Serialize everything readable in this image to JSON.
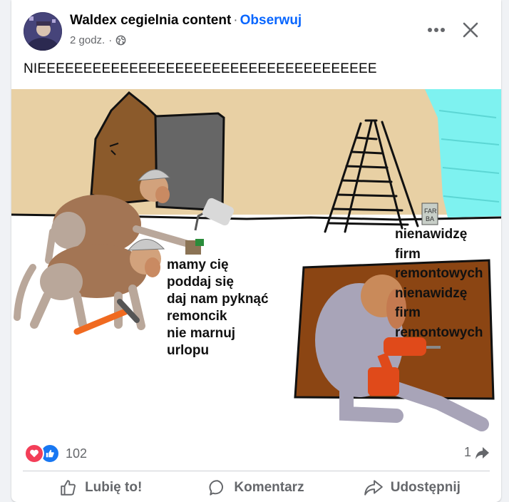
{
  "post": {
    "author": "Waldex cegielnia content",
    "separator": "·",
    "follow_label": "Obserwuj",
    "time": "2 godz.",
    "time_separator": "·",
    "text": "NIEEEEEEEEEEEEEEEEEEEEEEEEEEEEEEEEEEEEE"
  },
  "meme": {
    "left_caption": [
      "mamy cię",
      "poddaj się",
      "daj nam pyknąć",
      "remoncik",
      "nie marnuj",
      "urlopu"
    ],
    "right_caption": [
      "nienawidzę",
      "firm",
      "remontowych",
      "nienawidzę",
      "firm",
      "remontowych"
    ],
    "paint_label_line1": "FAR",
    "paint_label_line2": "BA"
  },
  "stats": {
    "reaction_count": "102",
    "share_count": "1",
    "reaction_icons": [
      "heart-icon",
      "thumbs-up-icon"
    ]
  },
  "actions": {
    "like_label": "Lubię to!",
    "comment_label": "Komentarz",
    "share_label": "Udostępnij"
  },
  "colors": {
    "link": "#0866ff",
    "wall": "#e8d0a4",
    "door": "#8b5a2b",
    "door_dark": "#666666",
    "cyan_paint": "#7ef2f0",
    "brown_box": "#8b4513",
    "love": "#f33e58",
    "like": "#1877f2"
  }
}
